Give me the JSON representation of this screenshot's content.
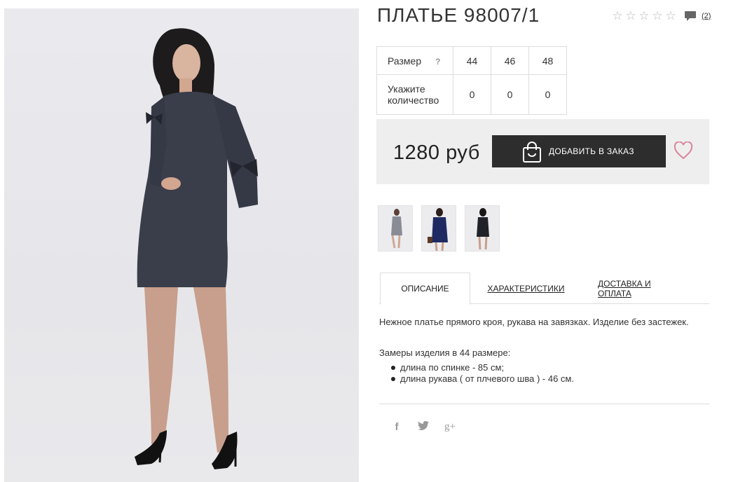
{
  "product": {
    "title": "ПЛАТЬЕ 98007/1",
    "rating": {
      "stars_filled": 0,
      "stars_total": 5,
      "review_count": "(2)"
    },
    "size_table": {
      "size_label": "Размер",
      "help_mark": "?",
      "sizes": [
        "44",
        "46",
        "48"
      ],
      "qty_label": "Укажите количество",
      "quantities": [
        "0",
        "0",
        "0"
      ]
    },
    "price": "1280 руб",
    "order_button_label": "ДОБАВИТЬ В ЗАКАЗ"
  },
  "tabs": [
    {
      "label": "ОПИСАНИЕ",
      "active": true
    },
    {
      "label": "ХАРАКТЕРИСТИКИ",
      "active": false
    },
    {
      "label": "ДОСТАВКА И ОПЛАТА",
      "active": false
    }
  ],
  "description": {
    "text": "Нежное платье прямого кроя, рукава на завязках. Изделие без застежек.",
    "measures_title": "Замеры изделия в 44 размере:",
    "measures": [
      "длина по спинке - 85 см;",
      "длина рукава ( от плчевого шва ) - 46 см."
    ]
  },
  "social": {
    "icons": [
      "facebook-icon",
      "twitter-icon",
      "google-plus-icon"
    ],
    "glyphs": [
      "f",
      "t",
      "g+"
    ]
  },
  "colors": {
    "button_bg": "#2d2d2d",
    "price_bar_bg": "#eeeeee",
    "heart": "#d9849a",
    "dress": "#3a3d4a"
  }
}
